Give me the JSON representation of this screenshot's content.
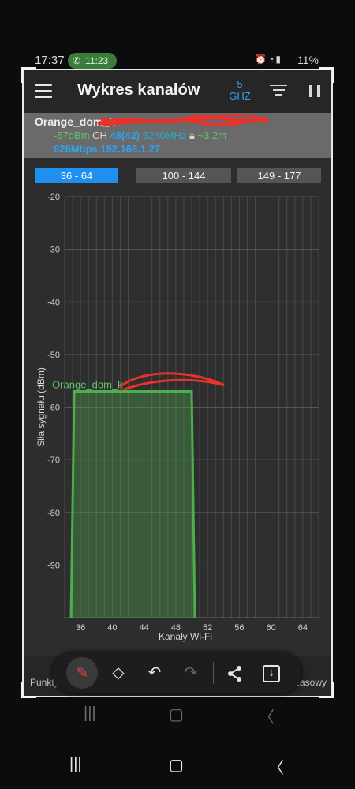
{
  "status_bar": {
    "time": "17:37",
    "call_time": "11:23",
    "battery": "11%"
  },
  "toolbar": {
    "title": "Wykres kanałów",
    "band_value": "5",
    "band_unit": "GHZ"
  },
  "network": {
    "ssid": "Orange_dom_k",
    "signal": "-57dBm",
    "ch_label": "CH",
    "channel": "48(42)",
    "frequency": "5240MHz",
    "distance": "~3.2m",
    "speed_ip": "626Mbps 192.168.1.27"
  },
  "tabs": [
    {
      "label": "36 - 64",
      "active": true
    },
    {
      "label": "100 - 144",
      "active": false
    },
    {
      "label": "149 - 177",
      "active": false
    }
  ],
  "chart_data": {
    "type": "area",
    "xlabel": "Kanały Wi-Fi",
    "ylabel": "Siła sygnału (dBm)",
    "ylim": [
      -100,
      -20
    ],
    "xlim": [
      34,
      66
    ],
    "y_ticks": [
      -20,
      -30,
      -40,
      -50,
      -60,
      -70,
      -80,
      -90
    ],
    "x_ticks": [
      36,
      40,
      44,
      48,
      52,
      56,
      60,
      64
    ],
    "grid": true,
    "series": [
      {
        "name": "Orange_dom_k",
        "channel_start": 35.2,
        "channel_end": 50,
        "level": -57,
        "color": "#4cae4c"
      }
    ]
  },
  "bottom_bar": {
    "left_label": "Punkty",
    "right_label": "zasowy"
  },
  "draw_tools": {
    "pen": "pen-icon",
    "eraser": "eraser-icon",
    "undo": "undo-icon",
    "redo": "redo-icon",
    "share": "share-icon",
    "save": "save-icon"
  },
  "colors": {
    "accent": "#1f8ff0",
    "series": "#4cae4c",
    "signal_text": "#5cc56a"
  }
}
